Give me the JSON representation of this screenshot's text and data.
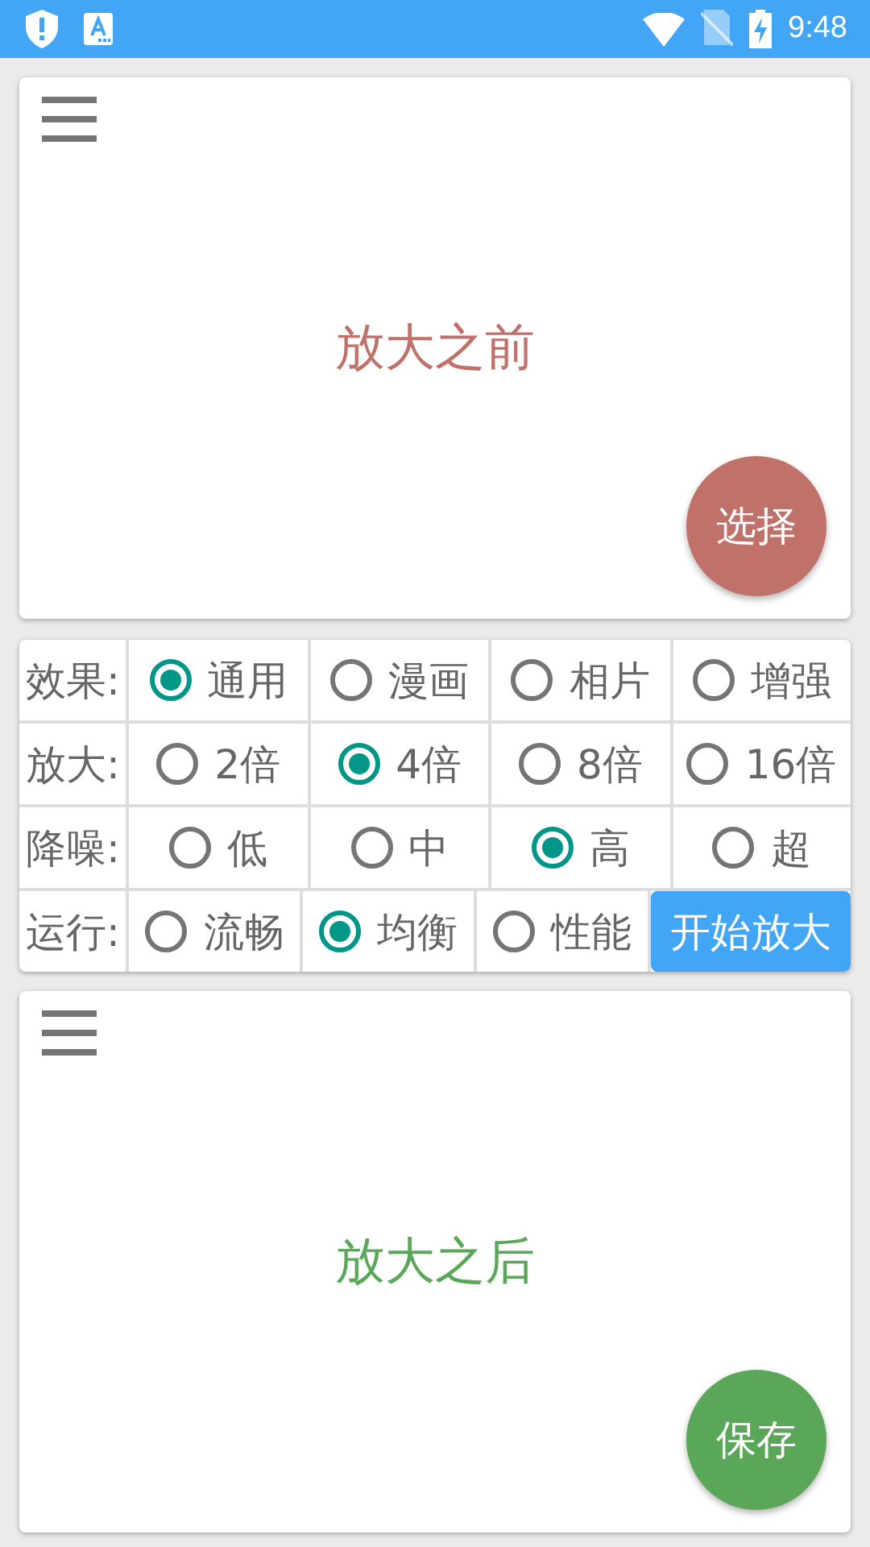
{
  "status_bar": {
    "time": "9:48"
  },
  "before_panel": {
    "caption": "放大之前",
    "button": "选择"
  },
  "options": [
    {
      "label": "效果:",
      "choices": [
        {
          "label": "通用",
          "selected": true
        },
        {
          "label": "漫画",
          "selected": false
        },
        {
          "label": "相片",
          "selected": false
        },
        {
          "label": "增强",
          "selected": false
        }
      ]
    },
    {
      "label": "放大:",
      "choices": [
        {
          "label": "2倍",
          "selected": false
        },
        {
          "label": "4倍",
          "selected": true
        },
        {
          "label": "8倍",
          "selected": false
        },
        {
          "label": "16倍",
          "selected": false
        }
      ]
    },
    {
      "label": "降噪:",
      "choices": [
        {
          "label": "低",
          "selected": false
        },
        {
          "label": "中",
          "selected": false
        },
        {
          "label": "高",
          "selected": true
        },
        {
          "label": "超",
          "selected": false
        }
      ]
    },
    {
      "label": "运行:",
      "choices": [
        {
          "label": "流畅",
          "selected": false
        },
        {
          "label": "均衡",
          "selected": true
        },
        {
          "label": "性能",
          "selected": false
        }
      ],
      "action": "开始放大"
    }
  ],
  "after_panel": {
    "caption": "放大之后",
    "button": "保存"
  }
}
